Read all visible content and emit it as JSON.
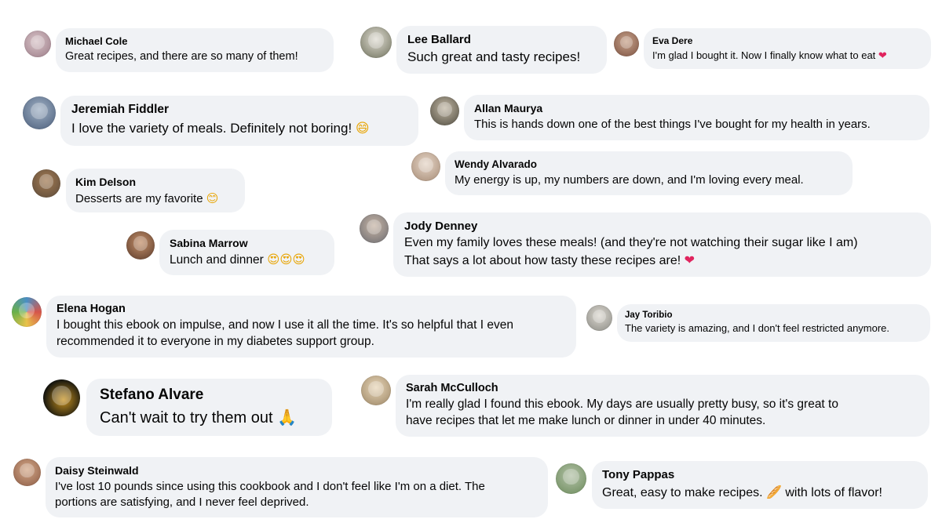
{
  "comments": [
    {
      "name": "Michael Cole",
      "text": "Great recipes, and there are so many of them!",
      "avatar_colors": [
        "#9a7a86",
        "#d8c4c8"
      ]
    },
    {
      "name": "Lee Ballard",
      "text": "Such great and tasty recipes!",
      "avatar_colors": [
        "#6d6f5a",
        "#e0ddd3"
      ]
    },
    {
      "name": "Eva Dere",
      "text": "I'm glad I bought it. Now I finally know what to eat",
      "emoji": "❤",
      "avatar_colors": [
        "#7a5040",
        "#c9a48c"
      ]
    },
    {
      "name": "Jeremiah Fiddler",
      "text": "I love the variety of meals. Definitely not boring!",
      "emoji": "😄",
      "avatar_colors": [
        "#4a5d7a",
        "#9fb0c4"
      ]
    },
    {
      "name": "Allan Maurya",
      "text": "This is hands down one of the best things I've bought for my health in years.",
      "avatar_colors": [
        "#4e4a3e",
        "#c2b8a5"
      ]
    },
    {
      "name": "Wendy Alvarado",
      "text": "My energy is up, my numbers are down, and I'm loving every meal.",
      "avatar_colors": [
        "#a58a74",
        "#e6d6c8"
      ]
    },
    {
      "name": "Kim Delson",
      "text": "Desserts are my favorite",
      "emoji": "😊",
      "avatar_colors": [
        "#5b4a3a",
        "#a27a52"
      ]
    },
    {
      "name": "Jody Denney",
      "text": "Even my family loves these meals! (and they're not watching their sugar like I am)",
      "text2": "That says a lot about how tasty these recipes are!",
      "emoji": "❤",
      "avatar_colors": [
        "#6a6a70",
        "#c8b6a6"
      ]
    },
    {
      "name": "Sabina Marrow",
      "text": "Lunch and dinner",
      "emoji": "😍😍😍",
      "avatar_colors": [
        "#5a3a2a",
        "#c4906a"
      ]
    },
    {
      "name": "Elena Hogan",
      "text": "I bought this ebook on impulse, and now I use it all the time. It's so helpful that I even",
      "text2": "recommended it to everyone in my diabetes support group.",
      "avatar_colors": [
        "#4a8fc4",
        "#d6554a"
      ]
    },
    {
      "name": "Jay Toribio",
      "text": "The variety is amazing, and I don't feel restricted anymore.",
      "avatar_colors": [
        "#8a8a84",
        "#dcd8d0"
      ]
    },
    {
      "name": "Stefano Alvare",
      "text": "Can't wait to try them out",
      "emoji": "🙏",
      "avatar_colors": [
        "#15150f",
        "#c8921e"
      ]
    },
    {
      "name": "Sarah McCulloch",
      "text": "I'm really glad I found this ebook. My days are usually pretty busy, so it's great to",
      "text2": "have recipes that let me make lunch or dinner in under 40 minutes.",
      "avatar_colors": [
        "#9a8464",
        "#e8d6b8"
      ]
    },
    {
      "name": "Daisy Steinwald",
      "text": "I've lost 10 pounds since using this cookbook and I don't feel like I'm on a diet. The",
      "text2": "portions are satisfying, and I never feel deprived.",
      "avatar_colors": [
        "#8a5a44",
        "#d4a888"
      ]
    },
    {
      "name": "Tony Pappas",
      "text": "Great, easy to make recipes.",
      "emoji": "🥖",
      "text_after": "with lots of flavor!",
      "avatar_colors": [
        "#6a8a5a",
        "#b4c2a8"
      ]
    }
  ]
}
